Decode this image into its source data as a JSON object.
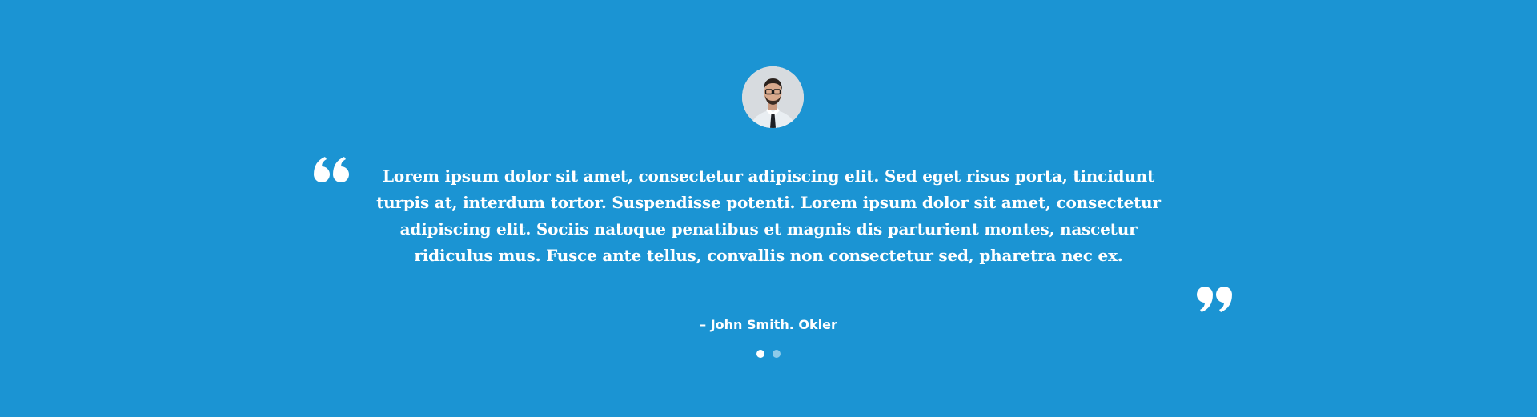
{
  "testimonial": {
    "quote": "Lorem ipsum dolor sit amet, consectetur adipiscing elit. Sed eget risus porta, tincidunt turpis at, interdum tortor. Suspendisse potenti. Lorem ipsum dolor sit amet, consectetur adipiscing elit. Sociis natoque penatibus et magnis dis parturient montes, nascetur ridiculus mus. Fusce ante tellus, convallis non consectetur sed, pharetra nec ex.",
    "author": "– John Smith. Okler"
  },
  "icons": {
    "open_quote": "left-quote-icon",
    "close_quote": "right-quote-icon"
  },
  "carousel": {
    "slides_total": 2,
    "active_slide": 1
  },
  "colors": {
    "background": "#1b94d3",
    "text": "#ffffff"
  }
}
